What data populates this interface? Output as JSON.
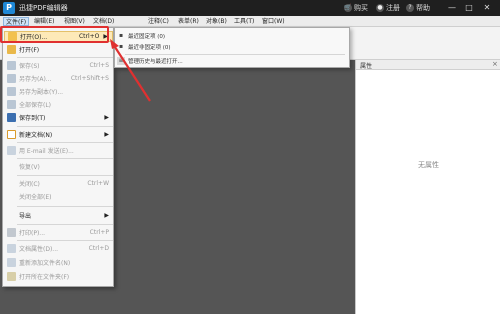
{
  "app": {
    "title": "迅捷PDF编辑器",
    "logo_letter": "P"
  },
  "titlebar": {
    "buy": "购买",
    "register": "注册",
    "help": "帮助",
    "buy_icon": "cart-icon",
    "register_icon": "user-icon",
    "help_icon": "question-icon",
    "minimize": "—",
    "maximize": "□",
    "close": "✕"
  },
  "menubar": [
    "文件(F)",
    "编辑(E)",
    "视图(V)",
    "文档(D)",
    "注释(C)",
    "表单(R)",
    "对象(B)",
    "工具(T)",
    "窗口(W)"
  ],
  "file_menu": {
    "items": [
      {
        "label": "打开(O)...",
        "shortcut": "Ctrl+O",
        "icon": "folder-open-icon",
        "submenu": true,
        "disabled": false
      },
      {
        "label": "打开(F)",
        "shortcut": "",
        "icon": "folder-icon",
        "submenu": false,
        "disabled": false
      },
      {
        "label": "保存(S)",
        "shortcut": "Ctrl+S",
        "icon": "save-icon",
        "submenu": false,
        "disabled": true
      },
      {
        "label": "另存为(A)...",
        "shortcut": "Ctrl+Shift+S",
        "icon": "save-as-icon",
        "submenu": false,
        "disabled": true
      },
      {
        "label": "另存为副本(Y)...",
        "shortcut": "",
        "icon": "save-copy-icon",
        "submenu": false,
        "disabled": true
      },
      {
        "label": "全部保存(L)",
        "shortcut": "",
        "icon": "save-all-icon",
        "submenu": false,
        "disabled": true
      },
      {
        "label": "保存到(T)",
        "shortcut": "",
        "icon": "save-to-icon",
        "submenu": true,
        "disabled": false
      },
      {
        "label": "新建文档(N)",
        "shortcut": "",
        "icon": "new-document-icon",
        "submenu": true,
        "disabled": false
      },
      {
        "label": "用 E-mail 发送(E)...",
        "shortcut": "",
        "icon": "email-icon",
        "submenu": false,
        "disabled": true
      },
      {
        "label": "恢复(V)",
        "shortcut": "",
        "icon": "",
        "submenu": false,
        "disabled": true
      },
      {
        "label": "关闭(C)",
        "shortcut": "Ctrl+W",
        "icon": "",
        "submenu": false,
        "disabled": true
      },
      {
        "label": "关闭全部(E)",
        "shortcut": "",
        "icon": "",
        "submenu": false,
        "disabled": true
      },
      {
        "label": "导出",
        "shortcut": "",
        "icon": "",
        "submenu": true,
        "disabled": false
      },
      {
        "label": "打印(P)...",
        "shortcut": "Ctrl+P",
        "icon": "print-icon",
        "submenu": false,
        "disabled": true
      },
      {
        "label": "文档属性(D)...",
        "shortcut": "Ctrl+D",
        "icon": "properties-icon",
        "submenu": false,
        "disabled": true
      },
      {
        "label": "重新添加文件名(N)",
        "shortcut": "",
        "icon": "rename-icon",
        "submenu": false,
        "disabled": true
      },
      {
        "label": "打开所在文件夹(F)",
        "shortcut": "",
        "icon": "open-folder-location-icon",
        "submenu": false,
        "disabled": true
      }
    ]
  },
  "recent_menu": {
    "items": [
      {
        "label": "最近固定项 (0)",
        "icon": "pin-icon"
      },
      {
        "label": "最近非固定项 (0)",
        "icon": "pin-icon"
      },
      {
        "label": "管理历史与最近打开...",
        "icon": "history-icon"
      }
    ]
  },
  "properties_panel": {
    "title": "属性",
    "close": "×",
    "empty_text": "无属性"
  },
  "colors": {
    "highlight_border": "#e03030",
    "arrow": "#e03030",
    "logo": "#1f88d6"
  }
}
